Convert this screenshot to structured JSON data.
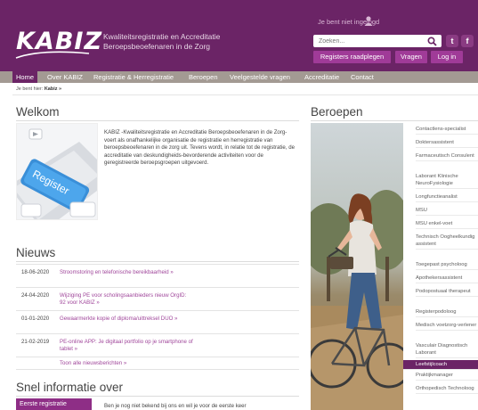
{
  "header": {
    "logo": "KABIZ",
    "tagline_line1": "Kwaliteitsregistratie en Accreditatie",
    "tagline_line2": "Beroepsbeoefenaren in de Zorg",
    "login_status": "Je bent niet ingelogd",
    "search_placeholder": "Zoeken...",
    "social": {
      "twitter": "t",
      "facebook": "f"
    },
    "buttons": {
      "registers": "Registers raadplegen",
      "vragen": "Vragen",
      "login": "Log in"
    },
    "colors": {
      "primary": "#6b2466",
      "button": "#a03b98",
      "nav": "#a39a93"
    }
  },
  "nav": {
    "items": [
      {
        "label": "Home"
      },
      {
        "label": "Over KABIZ"
      },
      {
        "label": "Registratie & Herregistratie"
      },
      {
        "label": "Beroepen"
      },
      {
        "label": "Veelgestelde vragen"
      },
      {
        "label": "Accreditatie"
      },
      {
        "label": "Contact"
      }
    ],
    "active": "Home"
  },
  "breadcrumb": {
    "prefix": "Je bent hier:",
    "current": "Kabiz »"
  },
  "welcome": {
    "heading": "Welkom",
    "image_text": "Register",
    "body": "KABIZ -Kwaliteitsregistratie en Accreditatie Beroepsbeoefenaren in de Zorg- voert als onafhankelijke organisatie de registratie en herregistratie van beroepsbeoefenaren in de zorg uit. Tevens wordt, in relatie tot de registratie, de accreditatie van deskundigheids-bevorderende activiteiten voor de geregistreerde beroepsgroepen uitgevoerd."
  },
  "news": {
    "heading": "Nieuws",
    "items": [
      {
        "date": "18-06-2020",
        "title": "Stroomstoring en telefonische bereikbaarheid »"
      },
      {
        "date": "24-04-2020",
        "title": "Wijziging PE voor scholingsaanbieders nieuw OrgID: 92 voor KABIZ »"
      },
      {
        "date": "01-01-2020",
        "title": "Gewaarmerkte kopie of diploma/uittreksel DUO »"
      },
      {
        "date": "21-02-2019",
        "title": "PE-online APP: Je digitaal portfolio op je smartphone of tablet »"
      }
    ],
    "more": "Toon alle nieuwsberichten »"
  },
  "snel": {
    "heading": "Snel informatie over",
    "first_registration": "Eerste registratie",
    "text": "Ben je nog niet bekend bij ons en wil je voor de eerste keer"
  },
  "beroepen": {
    "heading": "Beroepen",
    "items": [
      {
        "label": "Contactlens-specialist"
      },
      {
        "label": "Doktersassistent"
      },
      {
        "label": "Farmaceutisch Consulent"
      },
      {
        "label": "Laborant Klinische NeuroFysiologie"
      },
      {
        "label": "Longfunctieanalist"
      },
      {
        "label": "MSU"
      },
      {
        "label": "MSU enkel-voet"
      },
      {
        "label": "Technisch Oogheelkundig assistent"
      },
      {
        "label": "Toegepast psycholoog"
      },
      {
        "label": "Apothekersassistent"
      },
      {
        "label": "Podopostuaal therapeut"
      },
      {
        "label": "Registerpodoloog"
      },
      {
        "label": "Medisch voetzorg-verlener"
      },
      {
        "label": "Vasculair Diagnostisch Laborant"
      },
      {
        "label": "Leefstijlcoach"
      },
      {
        "label": "Praktijkmanager"
      },
      {
        "label": "Orthopedisch Technoloog"
      }
    ],
    "selected": "Leefstijlcoach"
  }
}
